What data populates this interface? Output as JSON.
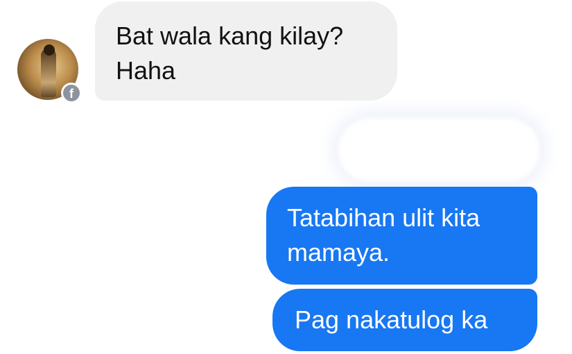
{
  "conversation": {
    "incoming": [
      {
        "text": "Bat wala kang kilay?\nHaha"
      }
    ],
    "outgoing": [
      {
        "text": "Tatabihan ulit kita\nmamaya."
      },
      {
        "text": "Pag nakatulog ka"
      }
    ],
    "sender_badge": {
      "icon": "facebook-icon",
      "glyph": "f"
    }
  },
  "colors": {
    "incoming_bubble": "#f0f0f0",
    "outgoing_bubble": "#1877f2",
    "badge": "#8d949e"
  }
}
